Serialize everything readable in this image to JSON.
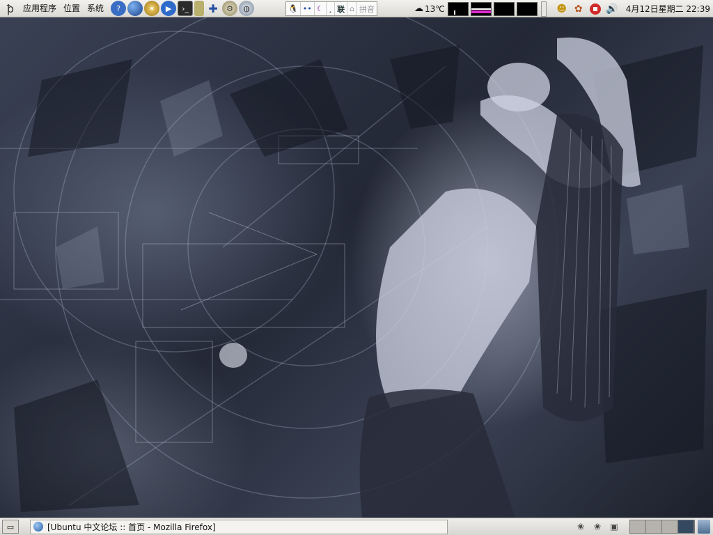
{
  "top_panel": {
    "menus": [
      "应用程序",
      "位置",
      "系统"
    ],
    "launcher_icons": [
      "help-icon",
      "browser-globe-icon",
      "compass-icon",
      "media-player-icon",
      "terminal-icon",
      "notes-icon",
      "update-icon",
      "network-icon",
      "globe-icon"
    ],
    "ime": {
      "lian": "联",
      "pinyin": "拼音"
    },
    "weather": {
      "temp": "13℃"
    },
    "clock": "4月12日星期二  22:39"
  },
  "bottom_panel": {
    "task_title": "[Ubuntu 中文论坛 :: 首页 - Mozilla Firefox]",
    "workspaces": 4,
    "active_workspace": 4
  },
  "colors": {
    "panel": "#dcdad5",
    "net_monitor": "#e02bd0",
    "active_workspace": "#34495f"
  }
}
